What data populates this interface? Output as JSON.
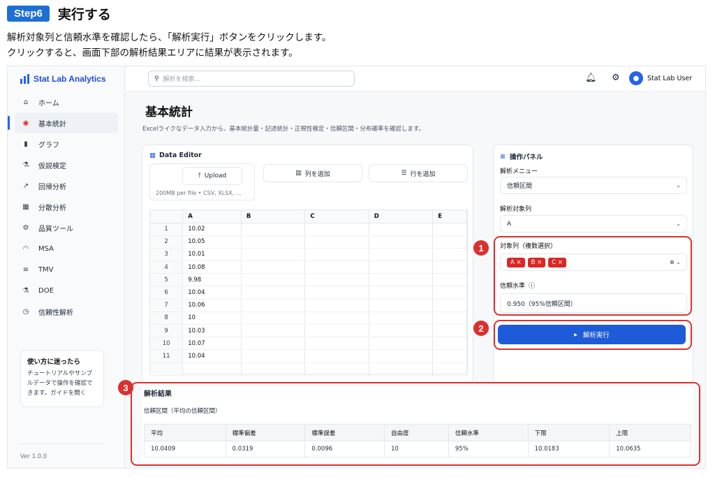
{
  "step": {
    "badge": "Step6",
    "title": "実行する"
  },
  "instructions": [
    "解析対象列と信頼水準を確認したら、「解析実行」ボタンをクリックします。",
    "クリックすると、画面下部の解析結果エリアに結果が表示されます。"
  ],
  "sidebar": {
    "brand": "Stat Lab Analytics",
    "items": [
      {
        "label": "ホーム",
        "icon": "home-icon"
      },
      {
        "label": "基本統計",
        "icon": "target-icon"
      },
      {
        "label": "グラフ",
        "icon": "bar-chart-icon"
      },
      {
        "label": "仮説検定",
        "icon": "flask-icon"
      },
      {
        "label": "回帰分析",
        "icon": "trend-icon"
      },
      {
        "label": "分散分析",
        "icon": "grid-icon"
      },
      {
        "label": "品質ツール",
        "icon": "gear-check-icon"
      },
      {
        "label": "MSA",
        "icon": "gauge-icon"
      },
      {
        "label": "TMV",
        "icon": "sliders-icon"
      },
      {
        "label": "DOE",
        "icon": "beaker-icon"
      },
      {
        "label": "信頼性解析",
        "icon": "clock-icon"
      }
    ],
    "help_title": "使い方に迷ったら",
    "help_body": "チュートリアルやサンプルデータで操作を確認できます。ガイドを開く",
    "version": "Ver 1.0.0"
  },
  "topbar": {
    "search_placeholder": "解析を検索...",
    "user": "Stat Lab User"
  },
  "page": {
    "title": "基本統計",
    "description": "Excelライクなデータ入力から、基本統計量・記述統計・正規性検定・信頼区間・分布確率を確認します。"
  },
  "editor": {
    "title": "Data Editor",
    "upload_label": "Upload",
    "upload_note": "200MB per file • CSV, XLSX, ...",
    "add_column": "列を追加",
    "add_row": "行を追加",
    "columns": [
      "",
      "A",
      "B",
      "C",
      "D",
      "E"
    ],
    "rows": [
      [
        "1",
        "10.02"
      ],
      [
        "2",
        "10.05"
      ],
      [
        "3",
        "10.01"
      ],
      [
        "4",
        "10.08"
      ],
      [
        "5",
        "9.98"
      ],
      [
        "6",
        "10.04"
      ],
      [
        "7",
        "10.06"
      ],
      [
        "8",
        "10"
      ],
      [
        "9",
        "10.03"
      ],
      [
        "10",
        "10.07"
      ],
      [
        "11",
        "10.04"
      ],
      [
        "",
        ""
      ]
    ]
  },
  "panel": {
    "title": "操作パネル",
    "menu_label": "解析メニュー",
    "menu_value": "信頼区間",
    "target_label": "解析対象列",
    "target_value": "A",
    "multi_label": "対象列（複数選択）",
    "tags": [
      "A ×",
      "B ×",
      "C ×"
    ],
    "conf_label": "信頼水準",
    "conf_value": "0.950（95%信頼区間）",
    "run_label": "解析実行"
  },
  "results": {
    "title": "解析結果",
    "subtitle": "信頼区間（平均の信頼区間）",
    "headers": [
      "平均",
      "標準偏差",
      "標準誤差",
      "自由度",
      "信頼水準",
      "下限",
      "上限"
    ],
    "values": [
      "10.0409",
      "0.0319",
      "0.0096",
      "10",
      "95%",
      "10.0183",
      "10.0635"
    ]
  },
  "callouts": [
    "1",
    "2",
    "3"
  ],
  "colors": {
    "accent": "#1d5bd8",
    "callout": "#d9312f",
    "tag": "#dc2626"
  }
}
